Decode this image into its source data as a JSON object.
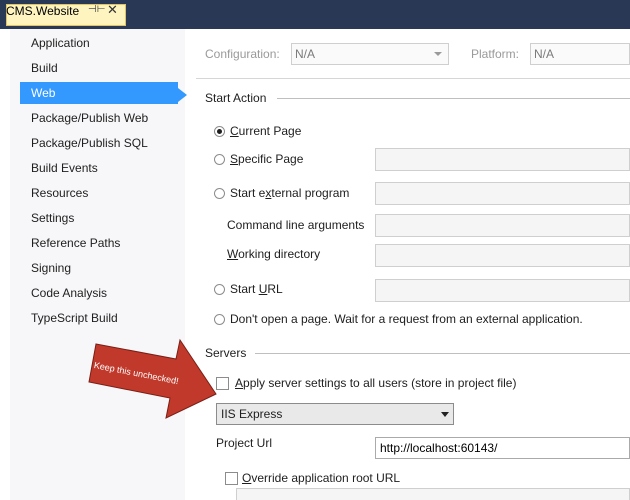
{
  "tab": {
    "title": "CMS.Website",
    "pin_glyph": "⊣⊢",
    "close_glyph": "✕"
  },
  "sidebar": {
    "items": [
      {
        "label": "Application"
      },
      {
        "label": "Build"
      },
      {
        "label": "Web",
        "selected": true
      },
      {
        "label": "Package/Publish Web"
      },
      {
        "label": "Package/Publish SQL"
      },
      {
        "label": "Build Events"
      },
      {
        "label": "Resources"
      },
      {
        "label": "Settings"
      },
      {
        "label": "Reference Paths"
      },
      {
        "label": "Signing"
      },
      {
        "label": "Code Analysis"
      },
      {
        "label": "TypeScript Build"
      }
    ]
  },
  "config": {
    "configuration_label": "Configuration:",
    "configuration_value": "N/A",
    "platform_label": "Platform:",
    "platform_value": "N/A"
  },
  "start_action": {
    "heading": "Start Action",
    "current_page": "urrent Page",
    "current_page_key": "C",
    "specific_page_key": "S",
    "specific_page": "pecific Page",
    "external_prefix": "Start e",
    "external_key": "x",
    "external_suffix": "ternal program",
    "cmd_args": "Command line arguments",
    "workdir_key": "W",
    "workdir": "orking directory",
    "start_url_prefix": "Start ",
    "start_url_key": "U",
    "start_url_suffix": "RL",
    "dont_open": "Don't open a page.  Wait for a request from an external application."
  },
  "servers": {
    "heading": "Servers",
    "apply_key": "A",
    "apply_label": "pply server settings to all users (store in project file)",
    "server_value": "IIS Express",
    "project_url_label": "Project Url",
    "project_url_value": "http://localhost:60143/",
    "override_key": "O",
    "override_label": "verride application root URL"
  },
  "annotation": {
    "text": "Keep this unchecked!",
    "color": "#c0392b"
  },
  "colors": {
    "tabstrip": "#293955",
    "tab_active": "#fdf4bf",
    "selection": "#3399ff"
  }
}
